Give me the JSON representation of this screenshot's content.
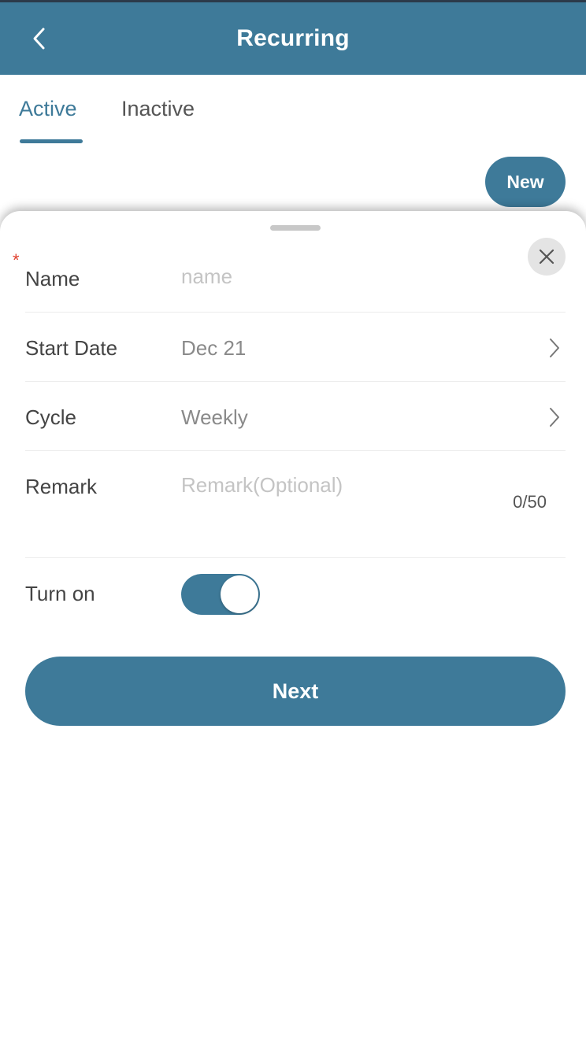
{
  "header": {
    "title": "Recurring",
    "back_icon": "chevron-left-icon"
  },
  "tabs": [
    {
      "label": "Active",
      "selected": true
    },
    {
      "label": "Inactive",
      "selected": false
    }
  ],
  "new_button": {
    "label": "New"
  },
  "sheet": {
    "close_icon": "close-icon",
    "fields": {
      "name": {
        "label": "Name",
        "placeholder": "name",
        "value": "",
        "required": "*"
      },
      "start_date": {
        "label": "Start Date",
        "value": "Dec 21"
      },
      "cycle": {
        "label": "Cycle",
        "value": "Weekly"
      },
      "remark": {
        "label": "Remark",
        "placeholder": "Remark(Optional)",
        "counter": "0/50"
      },
      "turn_on": {
        "label": "Turn on",
        "state": "on"
      }
    },
    "next_button": {
      "label": "Next"
    }
  },
  "colors": {
    "accent": "#3e7a99",
    "required": "#e0412f"
  }
}
